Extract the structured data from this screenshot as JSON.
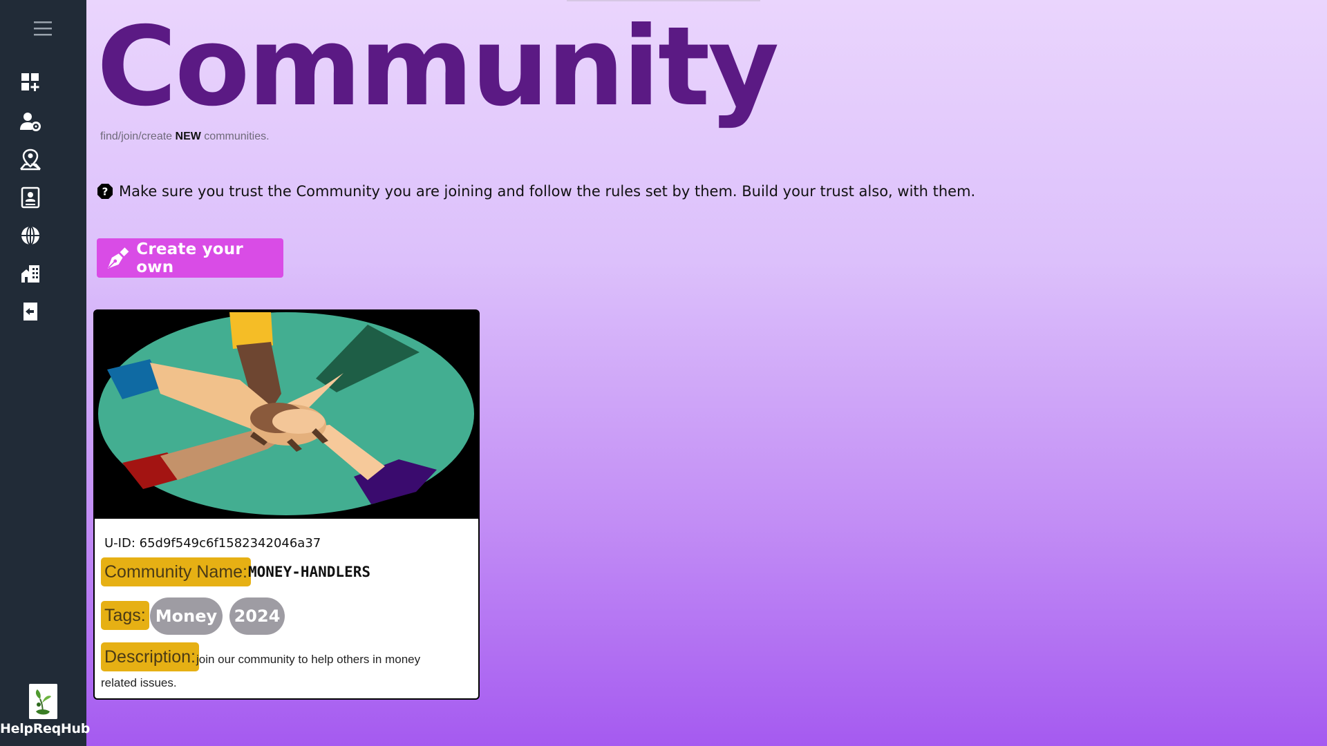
{
  "sidebar": {
    "brand": {
      "name": "HelpReqHub"
    },
    "nav_icons": [
      "dashboard-add-icon",
      "user-settings-icon",
      "location-user-icon",
      "contact-book-icon",
      "globe-icon",
      "buildings-icon",
      "logout-icon"
    ]
  },
  "page": {
    "title": "Community",
    "subtitle_prefix": "find/join/create ",
    "subtitle_bold": "NEW",
    "subtitle_suffix": " communities.",
    "notice": "Make sure you trust the Community you are joining and follow the rules set by them. Build your trust also, with them."
  },
  "actions": {
    "create_label": "Create your own"
  },
  "community_card": {
    "uid": "U-ID: 65d9f549c6f1582342046a37",
    "name_label": "Community Name:",
    "name_value": "MONEY-HANDLERS",
    "tags_label": "Tags:",
    "tags": [
      "Money",
      "2024"
    ],
    "description_label": "Description:",
    "description": "join our community to help others in money related issues."
  },
  "colors": {
    "sidebar": "#212b37",
    "title": "#5b1a84",
    "create_button": "#d94ce6",
    "label_highlight": "#e6b014",
    "tag_bg": "#9e9ca3"
  }
}
